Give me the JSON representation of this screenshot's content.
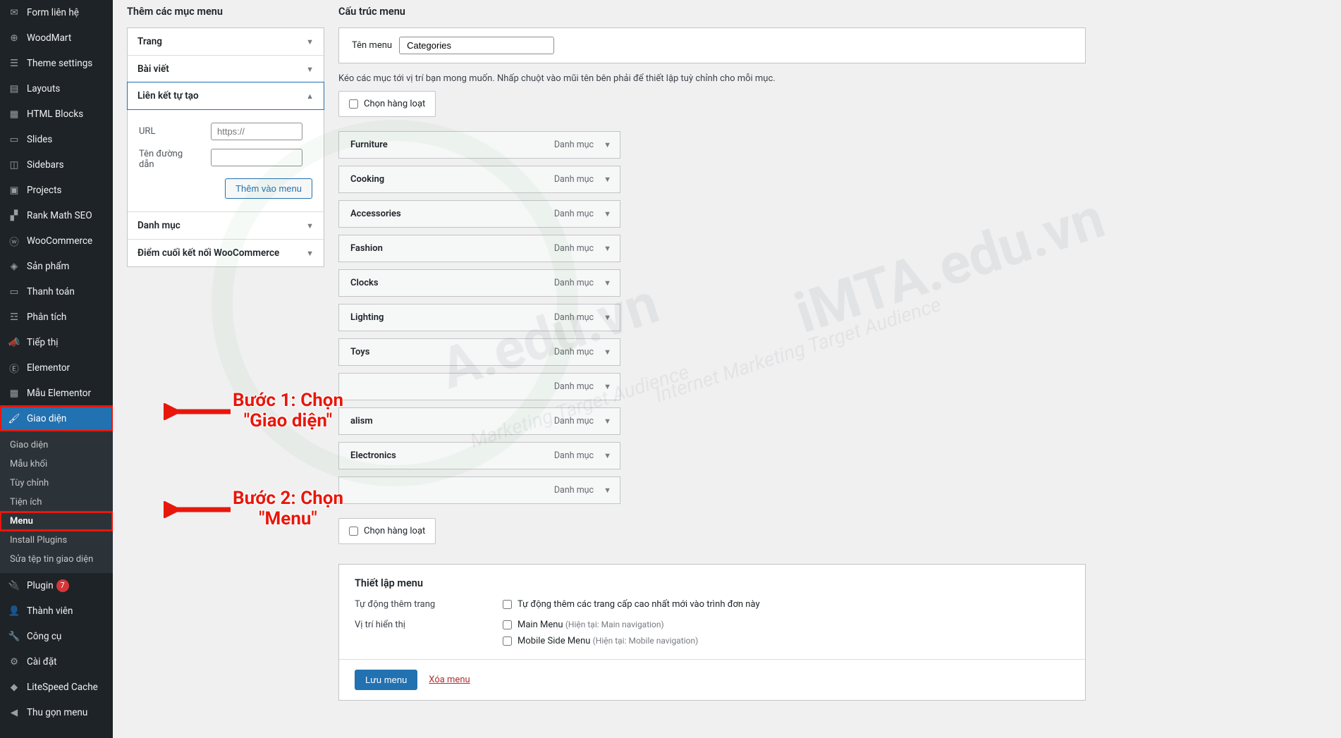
{
  "sidebar": {
    "items": [
      {
        "icon": "form",
        "label": "Form liên hệ"
      },
      {
        "icon": "woodmart",
        "label": "WoodMart"
      },
      {
        "icon": "theme",
        "label": "Theme settings"
      },
      {
        "icon": "layouts",
        "label": "Layouts"
      },
      {
        "icon": "html",
        "label": "HTML Blocks"
      },
      {
        "icon": "slides",
        "label": "Slides"
      },
      {
        "icon": "sidebars",
        "label": "Sidebars"
      },
      {
        "icon": "projects",
        "label": "Projects"
      },
      {
        "icon": "seo",
        "label": "Rank Math SEO"
      },
      {
        "icon": "woo",
        "label": "WooCommerce"
      },
      {
        "icon": "products",
        "label": "Sản phẩm"
      },
      {
        "icon": "payment",
        "label": "Thanh toán"
      },
      {
        "icon": "analytics",
        "label": "Phân tích"
      },
      {
        "icon": "marketing",
        "label": "Tiếp thị"
      },
      {
        "icon": "elementor",
        "label": "Elementor"
      },
      {
        "icon": "template",
        "label": "Mẫu Elementor"
      },
      {
        "icon": "appearance",
        "label": "Giao diện",
        "active": true
      },
      {
        "icon": "plugins",
        "label": "Plugin",
        "badge": "7"
      },
      {
        "icon": "users",
        "label": "Thành viên"
      },
      {
        "icon": "tools",
        "label": "Công cụ"
      },
      {
        "icon": "settings",
        "label": "Cài đặt"
      },
      {
        "icon": "litespeed",
        "label": "LiteSpeed Cache"
      },
      {
        "icon": "collapse",
        "label": "Thu gọn menu"
      }
    ],
    "submenu": [
      {
        "label": "Giao diện"
      },
      {
        "label": "Mẫu khối"
      },
      {
        "label": "Tùy chỉnh"
      },
      {
        "label": "Tiện ích"
      },
      {
        "label": "Menu",
        "current": true
      },
      {
        "label": "Install Plugins"
      },
      {
        "label": "Sửa tệp tin giao diện"
      }
    ]
  },
  "callouts": {
    "step1_l1": "Bước 1: Chọn",
    "step1_l2": "\"Giao diện\"",
    "step2_l1": "Bước 2: Chọn",
    "step2_l2": "\"Menu\""
  },
  "left": {
    "heading": "Thêm các mục menu",
    "acc": {
      "page": "Trang",
      "post": "Bài viết",
      "custom": "Liên kết tự tạo",
      "cat": "Danh mục",
      "woo": "Điểm cuối kết nối WooCommerce"
    },
    "url_label": "URL",
    "url_placeholder": "https://",
    "name_label": "Tên đường dẫn",
    "add_btn": "Thêm vào menu"
  },
  "right": {
    "heading": "Cấu trúc menu",
    "menu_name_label": "Tên menu",
    "menu_name_value": "Categories",
    "helper": "Kéo các mục tới vị trí bạn mong muốn. Nhấp chuột vào mũi tên bên phải để thiết lập tuỳ chỉnh cho mỗi mục.",
    "bulk_label": "Chọn hàng loạt",
    "item_type": "Danh mục",
    "items": [
      "Furniture",
      "Cooking",
      "Accessories",
      "Fashion",
      "Clocks",
      "Lighting",
      "Toys",
      "",
      "alism",
      "Electronics",
      ""
    ],
    "settings": {
      "title": "Thiết lập menu",
      "auto_label": "Tự động thêm trang",
      "auto_chk": "Tự động thêm các trang cấp cao nhất mới vào trình đơn này",
      "loc_label": "Vị trí hiển thị",
      "loc1": "Main Menu",
      "loc1_note": "(Hiện tại: Main navigation)",
      "loc2": "Mobile Side Menu",
      "loc2_note": "(Hiện tại: Mobile navigation)"
    },
    "save_btn": "Lưu menu",
    "delete_link": "Xóa menu"
  },
  "watermark": {
    "large1": "iMTA.edu.vn",
    "large2": "A.edu.vn",
    "sub1": "Internet Marketing Target Audience",
    "sub2": "Marketing Target Audience"
  }
}
